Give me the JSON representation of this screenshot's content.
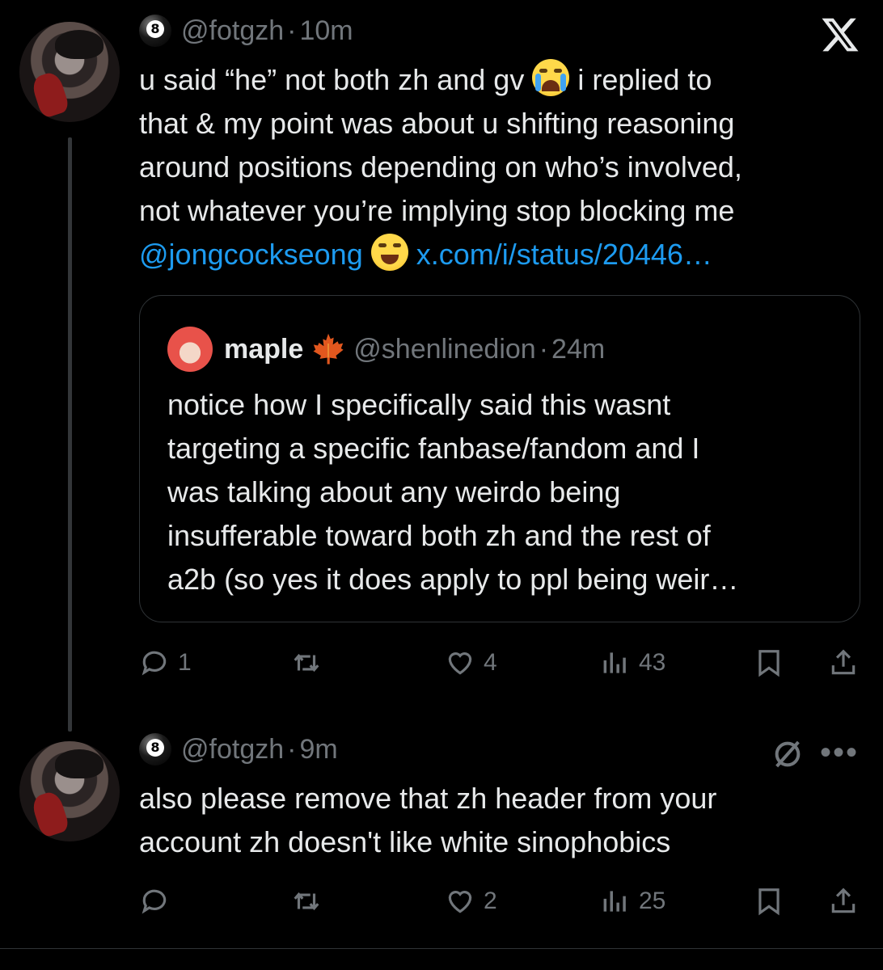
{
  "tweets": [
    {
      "handle": "@fotgzh",
      "separator": "·",
      "time": "10m",
      "text_lines": [
        {
          "parts": [
            {
              "t": "u said “he” not both zh and gv ",
              "kind": "text"
            },
            {
              "t": "loudly-crying-face",
              "kind": "emoji-cry"
            },
            {
              "t": " i replied to\nthat & my point was about u shifting reasoning\naround positions depending on who’s involved,\nnot whatever you’re implying stop blocking me\n",
              "kind": "text"
            },
            {
              "t": "@jongcockseong",
              "kind": "link"
            },
            {
              "t": " ",
              "kind": "text"
            },
            {
              "t": "face-with-tears-of-joy",
              "kind": "emoji-joy"
            },
            {
              "t": " ",
              "kind": "text"
            },
            {
              "t": "x.com/i/status/20446…",
              "kind": "link"
            }
          ]
        }
      ],
      "quote": {
        "name": "maple",
        "handle": "@shenlinedion",
        "separator": "·",
        "time": "24m",
        "text": "notice how I specifically said this wasnt\ntargeting a specific fanbase/fandom and I\nwas talking about any weirdo being\ninsufferable toward both zh and the rest of\na2b (so yes it does apply to ppl being weir…"
      },
      "actions": {
        "replies": "1",
        "reposts": "",
        "likes": "4",
        "views": "43"
      }
    },
    {
      "handle": "@fotgzh",
      "separator": "·",
      "time": "9m",
      "text": "also please remove that zh header from your\naccount zh doesn't like white sinophobics",
      "actions": {
        "replies": "",
        "reposts": "",
        "likes": "2",
        "views": "25"
      }
    }
  ],
  "icons": {
    "logo": "x-logo-icon",
    "grok": "grok-slash-icon",
    "more": "more-dots-icon",
    "badge": "8-ball-emoji-icon",
    "maple": "maple-leaf-icon"
  },
  "colors": {
    "background": "#000000",
    "text": "#e7e9ea",
    "muted": "#71767b",
    "link": "#1d9bf0",
    "border": "#2f3336"
  }
}
